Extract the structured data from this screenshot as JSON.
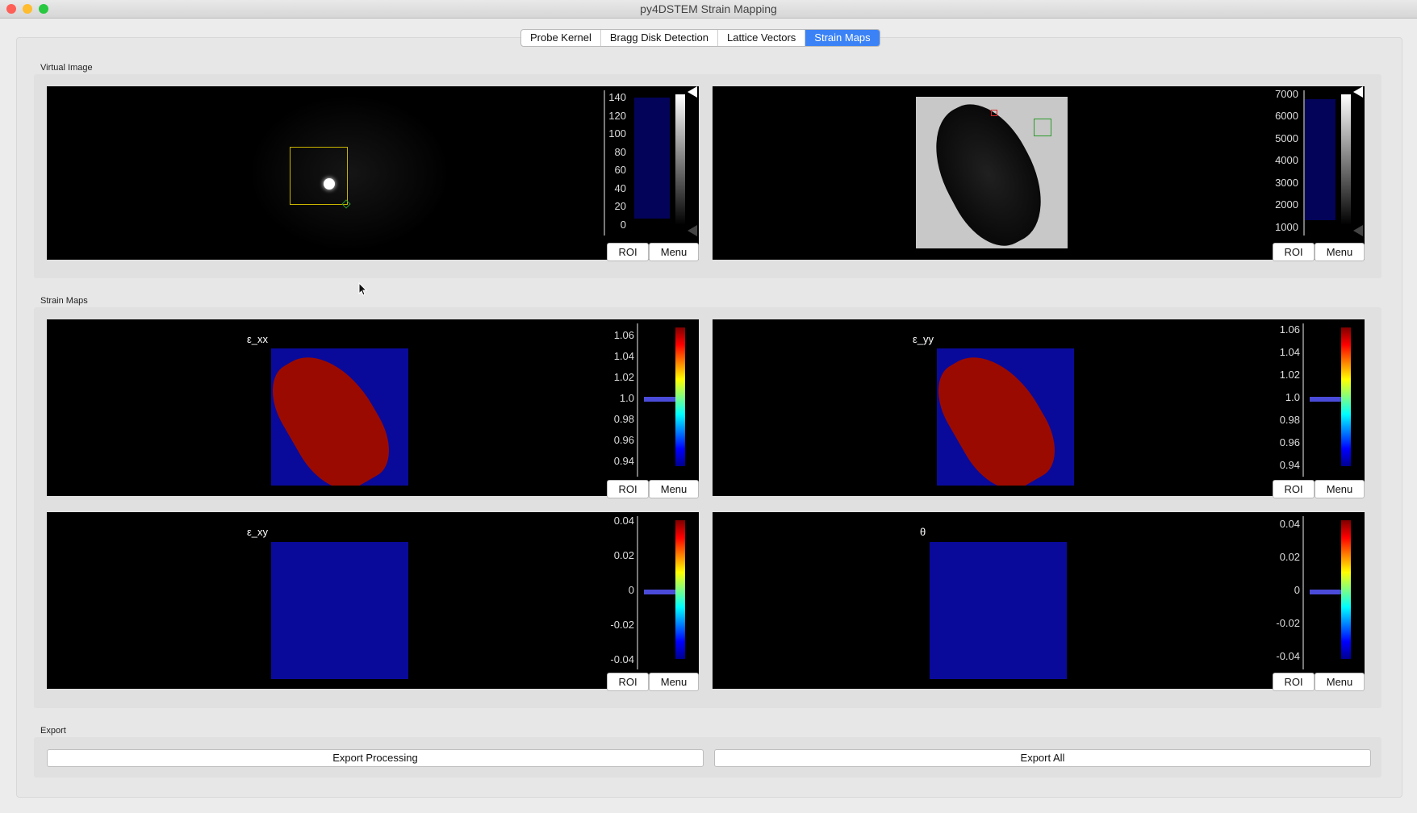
{
  "window": {
    "title": "py4DSTEM Strain Mapping"
  },
  "colors": {
    "active_tab": "#3b82f6",
    "panel_bg": "#000000",
    "strain_map_blue": "#0a0a9a",
    "strain_map_red": "#9b0a00"
  },
  "tabs": [
    {
      "label": "Probe Kernel",
      "active": false
    },
    {
      "label": "Bragg Disk Detection",
      "active": false
    },
    {
      "label": "Lattice Vectors",
      "active": false
    },
    {
      "label": "Strain Maps",
      "active": true
    }
  ],
  "sections": {
    "virtual_image": "Virtual Image",
    "strain_maps": "Strain Maps",
    "export": "Export"
  },
  "virtual_left": {
    "ticks": [
      "140",
      "120",
      "100",
      "80",
      "60",
      "40",
      "20",
      "0"
    ]
  },
  "virtual_right": {
    "ticks": [
      "7000",
      "6000",
      "5000",
      "4000",
      "3000",
      "2000",
      "1000"
    ]
  },
  "strain": {
    "exx": {
      "label": "ε_xx",
      "ticks": [
        "1.06",
        "1.04",
        "1.02",
        "1.0",
        "0.98",
        "0.96",
        "0.94"
      ]
    },
    "eyy": {
      "label": "ε_yy",
      "ticks": [
        "1.06",
        "1.04",
        "1.02",
        "1.0",
        "0.98",
        "0.96",
        "0.94"
      ]
    },
    "exy": {
      "label": "ε_xy",
      "ticks": [
        "0.04",
        "0.02",
        "0",
        "-0.02",
        "-0.04"
      ]
    },
    "theta": {
      "label": "θ",
      "ticks": [
        "0.04",
        "0.02",
        "0",
        "-0.02",
        "-0.04"
      ]
    }
  },
  "buttons": {
    "roi": "ROI",
    "menu": "Menu",
    "export_processing": "Export Processing",
    "export_all": "Export All"
  },
  "icons": {
    "mouse": "mouse-cursor-icon",
    "histogram": "histogram-icon",
    "level_handle": "level-handle-icon"
  }
}
